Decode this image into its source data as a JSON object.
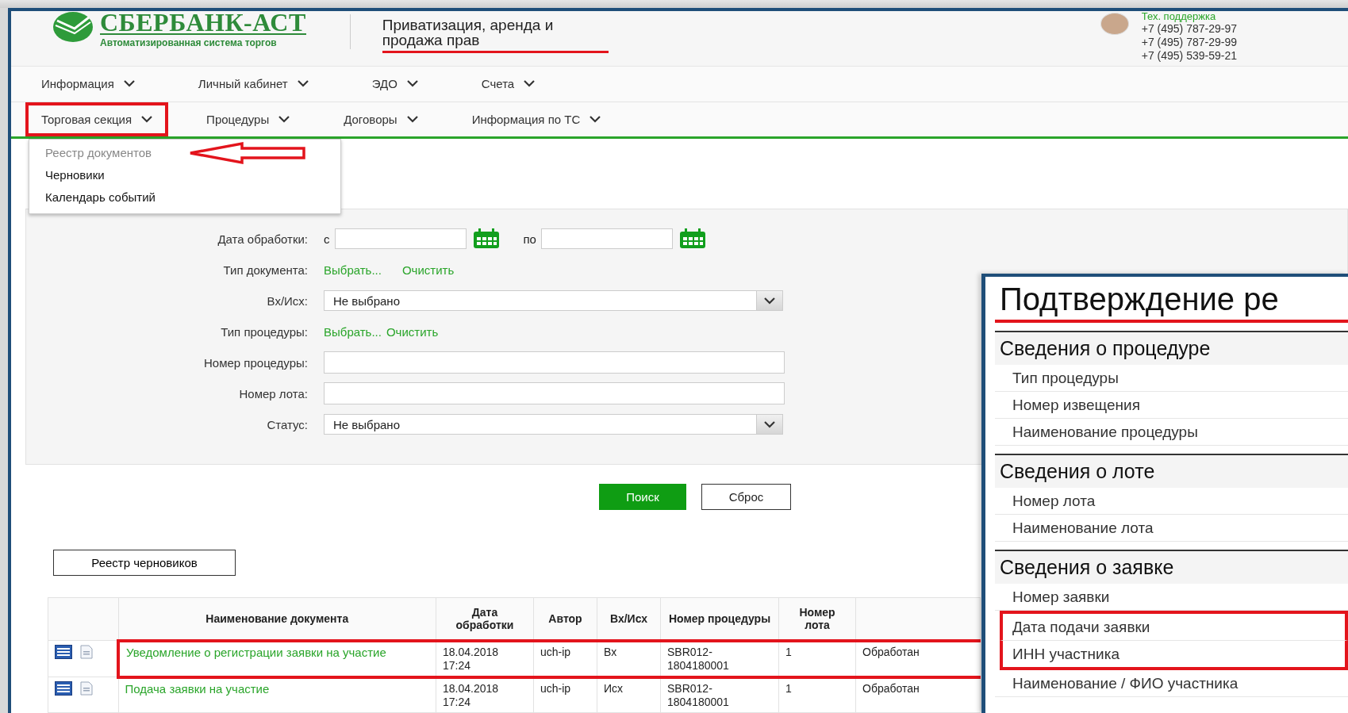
{
  "header": {
    "logo_title": "СБЕРБАНК-АСТ",
    "logo_subtitle": "Автоматизированная система торгов",
    "section_title": "Приватизация, аренда и продажа прав",
    "section_title_underlined": true,
    "support": {
      "label": "Тех. поддержка",
      "phones": [
        "+7 (495) 787-29-97",
        "+7 (495) 787-29-99",
        "+7 (495) 539-59-21"
      ]
    }
  },
  "nav_primary": [
    {
      "label": "Информация",
      "highlighted": false
    },
    {
      "label": "Личный кабинет",
      "highlighted": false
    },
    {
      "label": "ЭДО",
      "highlighted": false
    },
    {
      "label": "Счета",
      "highlighted": false
    }
  ],
  "nav_secondary": [
    {
      "label": "Торговая секция",
      "highlighted": true
    },
    {
      "label": "Процедуры",
      "highlighted": false
    },
    {
      "label": "Договоры",
      "highlighted": false
    },
    {
      "label": "Информация по ТС",
      "highlighted": false
    }
  ],
  "dropdown": {
    "items": [
      {
        "label": "Реестр документов",
        "disabled": true,
        "annotated": true
      },
      {
        "label": "Черновики",
        "disabled": false,
        "annotated": false
      },
      {
        "label": "Календарь событий",
        "disabled": false,
        "annotated": false
      }
    ]
  },
  "filters": [
    {
      "kind": "date_range",
      "label": "Дата обработки:",
      "from_label": "с",
      "to_label": "по"
    },
    {
      "kind": "links",
      "label": "Тип документа:",
      "links": [
        "Выбрать...",
        "Очистить"
      ],
      "spaced": true
    },
    {
      "kind": "select",
      "label": "Вх/Исх:",
      "value": "Не выбрано"
    },
    {
      "kind": "links",
      "label": "Тип процедуры:",
      "links": [
        "Выбрать...",
        "Очистить"
      ],
      "spaced": false
    },
    {
      "kind": "text",
      "label": "Номер процедуры:"
    },
    {
      "kind": "text",
      "label": "Номер лота:"
    },
    {
      "kind": "select",
      "label": "Статус:",
      "value": "Не выбрано"
    }
  ],
  "buttons": [
    {
      "label": "Поиск",
      "kind": "primary"
    },
    {
      "label": "Сброс",
      "kind": "secondary"
    }
  ],
  "drafts_button": "Реестр черновиков",
  "table": {
    "columns": [
      "Наименование документа",
      "Дата обработки",
      "Автор",
      "Вх/Исх",
      "Номер процедуры",
      "Номер лота"
    ],
    "rows": [
      {
        "name": "Уведомление о регистрации заявки на участие",
        "date": "18.04.2018",
        "time": "17:24",
        "author": "uch-ip",
        "direction": "Вх",
        "procedure_number": "SBR012-1804180001",
        "lot": "1",
        "status": "Обработан",
        "highlighted": true
      },
      {
        "name": "Подача заявки на участие",
        "date": "18.04.2018",
        "time": "17:24",
        "author": "uch-ip",
        "direction": "Исх",
        "procedure_number": "SBR012-1804180001",
        "lot": "1",
        "status": "Обработан",
        "highlighted": false
      }
    ]
  },
  "overlay": {
    "title": "Подтверждение ре",
    "title_underlined": true,
    "sections": [
      {
        "title": "Сведения о процедуре",
        "rows": [
          {
            "label": "Тип процедуры",
            "highlighted": false
          },
          {
            "label": "Номер извещения",
            "highlighted": false
          },
          {
            "label": "Наименование процедуры",
            "highlighted": false
          }
        ]
      },
      {
        "title": "Сведения о лоте",
        "rows": [
          {
            "label": "Номер лота",
            "highlighted": false
          },
          {
            "label": "Наименование лота",
            "highlighted": false
          }
        ]
      },
      {
        "title": "Сведения о заявке",
        "rows": [
          {
            "label": "Номер заявки",
            "highlighted": false
          },
          {
            "label": "Дата подачи заявки",
            "highlighted": true
          },
          {
            "label": "ИНН участника",
            "highlighted": true
          },
          {
            "label": "Наименование / ФИО участника",
            "highlighted": false
          }
        ]
      }
    ]
  }
}
